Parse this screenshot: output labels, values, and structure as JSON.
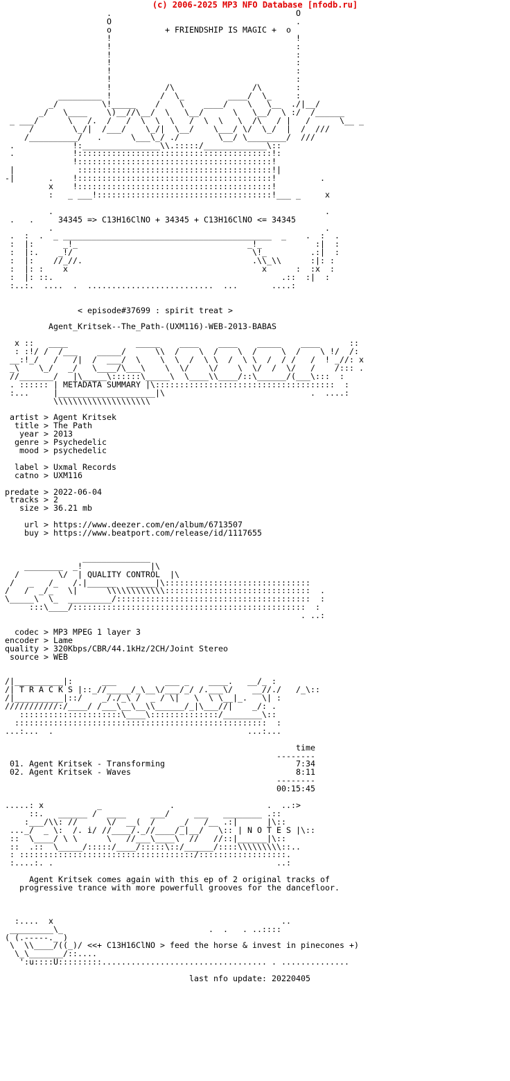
{
  "window": {
    "title": "Agent_Kritsek--The_Path-(UXM116)-WEB-2013-BABAS",
    "background_color": "#ffffff",
    "text_color": "#000000"
  },
  "header": {
    "text": "(c) 2006-2025 MP3 NFO Database [nfodb.ru]",
    "color": "#e00000"
  },
  "logo": {
    "tagline": "+ FRIENDSHIP IS MAGIC +",
    "formula_line": "34345 => C13H16ClNO + 34345 + C13H16ClNO <= 34345",
    "episode_line": "< episode#37699 : spirit treat >",
    "release_name": "Agent_Kritsek--The_Path-(UXM116)-WEB-2013-BABAS"
  },
  "metadata": {
    "banner_label": "METADATA SUMMARY",
    "fields": [
      {
        "key": "artist",
        "value": "Agent Kritsek"
      },
      {
        "key": "title",
        "value": "The Path"
      },
      {
        "key": "year",
        "value": "2013"
      },
      {
        "key": "genre",
        "value": "Psychedelic"
      },
      {
        "key": "mood",
        "value": "psychedelic"
      },
      {
        "key": "label",
        "value": "Uxmal Records"
      },
      {
        "key": "catno",
        "value": "UXM116"
      },
      {
        "key": "predate",
        "value": "2022-06-04"
      },
      {
        "key": "tracks",
        "value": "2"
      },
      {
        "key": "size",
        "value": "36.21 mb"
      },
      {
        "key": "url",
        "value": "https://www.deezer.com/en/album/6713507"
      },
      {
        "key": "buy",
        "value": "https://www.beatport.com/release/id/1117655"
      }
    ],
    "block": "  artist > Agent Kritsek\n   title > The Path\n    year > 2013\n   genre > Psychedelic\n    mood > psychedelic\n\n   label > Uxmal Records\n   catno > UXM116\n\n predate > 2022-06-04\n  tracks > 2\n    size > 36.21 mb\n\n     url > https://www.deezer.com/en/album/6713507\n     buy > https://www.beatport.com/release/id/1117655"
  },
  "quality": {
    "banner_label": "QUALITY CONTROL",
    "fields": [
      {
        "key": "codec",
        "value": "MP3 MPEG 1 layer 3"
      },
      {
        "key": "encoder",
        "value": "Lame"
      },
      {
        "key": "quality",
        "value": "320Kbps/CBR/44.1kHz/2CH/Joint Stereo"
      },
      {
        "key": "source",
        "value": "WEB"
      }
    ],
    "block": "   codec > MP3 MPEG 1 layer 3\n encoder > Lame\n quality > 320Kbps/CBR/44.1kHz/2CH/Joint Stereo\n  source > WEB"
  },
  "tracks": {
    "banner_label": "T R A C K S",
    "time_header": "time",
    "rule": "--------",
    "items": [
      {
        "num": "01.",
        "title": "Agent Kritsek - Transforming",
        "time": "7:34"
      },
      {
        "num": "02.",
        "title": "Agent Kritsek - Waves",
        "time": "8:11"
      }
    ],
    "total_time": "00:15:45",
    "block": "                                                             time\n                                                         --------\n  01. Agent Kritsek - Transforming                           7:34\n  02. Agent Kritsek - Waves                                  8:11\n                                                         --------\n                                                         00:15:45"
  },
  "notes": {
    "banner_label": "N O T E S",
    "lines": [
      "Agent Kritsek comes again with this ep of 2 original tracks of",
      "progressive trance with more powerfull grooves for the dancefloor."
    ],
    "block": "      Agent Kritsek comes again with this ep of 2 original tracks of\n    progressive trance with more powerfull grooves for the dancefloor."
  },
  "footer": {
    "greet": "<<+ C13H16ClNO > feed the horse & invest in pinecones +)",
    "last_update_label": "last nfo update:",
    "last_update_value": "20220405",
    "last_update_line": "                                       last nfo update: 20220405"
  },
  "ascii": {
    "logo_top": "                      .                          O\n                      O                          .\n           + FRIENDSHIP IS MAGIC +               o\n                      o                          !\n                      !                          :\n                      :                          :\n                      :                          :\n                      !                          :\n        .             !        _                 :\n       /_\\___  _______!_____  /_\\__        ______:__.\n  _ __/// \\__ \\)__//_ \\\\\\ \\_/)__//_ \\\\  ./_ \\_ / ____ _\n /  \\___ \\: /  / \\__ \\: /  / \\__ \\: \\ :/__\\/ ///\n /______\\/ ._//  \\___\\/ ._//  \\___\\/_ \\/______\\",
    "logo_body": "            !:_________\\\\.::::::/________\\::\n            ::::::::::::::::::::::::::::::::\n            ::::::::::::::::::::::::::::::::\n             ::::::::::::::::::::::::::::::::",
    "curve_band": ":  .    _ ___::::::::::::::::::::::::::::::::___ _",
    "footer_art": "  /.....  \\\n ( (.-----._ )\n  \\  \\\\____/((_)/"
  }
}
